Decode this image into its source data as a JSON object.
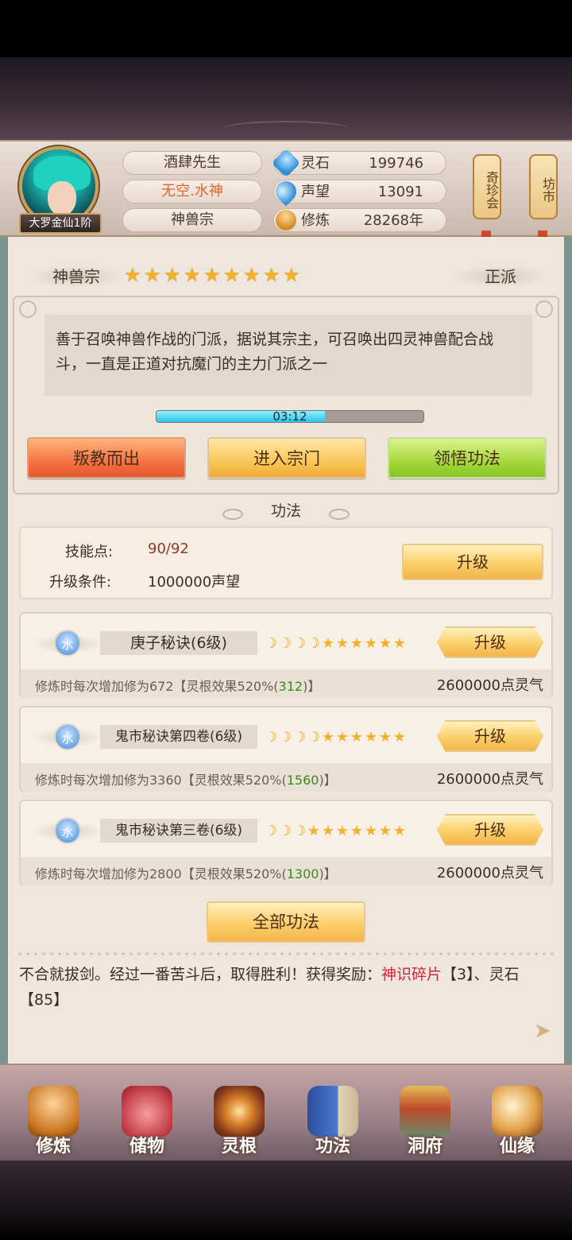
{
  "header": {
    "rank": "大罗金仙1阶",
    "player_name": "酒肆先生",
    "title": "无空.水神",
    "sect": "神兽宗",
    "stats": [
      {
        "icon": "spirit-stone-icon",
        "label": "灵石",
        "value": "199746"
      },
      {
        "icon": "reputation-icon",
        "label": "声望",
        "value": "13091"
      },
      {
        "icon": "cultivation-icon",
        "label": "修炼",
        "value": "28268年"
      }
    ],
    "side_tags": [
      {
        "label": "奇珍会"
      },
      {
        "label": "坊市"
      }
    ]
  },
  "sect_panel": {
    "name": "神兽宗",
    "stars": 9,
    "faction": "正派",
    "description": "善于召唤神兽作战的门派，据说其宗主，可召唤出四灵神兽配合战斗，一直是正道对抗魔门的主力门派之一",
    "timer": "03:12",
    "timer_progress": 0.63,
    "buttons": {
      "leave": "叛教而出",
      "enter": "进入宗门",
      "comprehend": "领悟功法"
    }
  },
  "gongfa": {
    "section_title": "功法",
    "skill_points_label": "技能点:",
    "skill_points_value": "90/92",
    "upgrade_cond_label": "升级条件:",
    "upgrade_cond_value": "1000000声望",
    "upgrade_label": "升级",
    "techniques": [
      {
        "element": "水",
        "name": "庚子秘诀(6级)",
        "moons": 4,
        "stars": 6,
        "desc_prefix": "修炼时每次增加修为672【灵根效果520%(",
        "desc_bonus": "312",
        "desc_suffix": ")】",
        "cost": "2600000点灵气",
        "button": "升级"
      },
      {
        "element": "水",
        "name": "鬼市秘诀第四卷(6级)",
        "moons": 4,
        "stars": 6,
        "desc_prefix": "修炼时每次增加修为3360【灵根效果520%(",
        "desc_bonus": "1560",
        "desc_suffix": ")】",
        "cost": "2600000点灵气",
        "button": "升级"
      },
      {
        "element": "水",
        "name": "鬼市秘诀第三卷(6级)",
        "moons": 3,
        "stars": 7,
        "desc_prefix": "修炼时每次增加修为2800【灵根效果520%(",
        "desc_bonus": "1300",
        "desc_suffix": ")】",
        "cost": "2600000点灵气",
        "button": "升级"
      }
    ],
    "all_button": "全部功法"
  },
  "log": {
    "text1": "不合就拔剑。经过一番苦斗后，取得胜利！获得奖励：",
    "reward1": "神识碎片",
    "text2": "【3】、灵石【85】"
  },
  "nav": [
    {
      "label": "修炼",
      "icon": "cultivate-icon"
    },
    {
      "label": "储物",
      "icon": "storage-bag-icon"
    },
    {
      "label": "灵根",
      "icon": "spirit-root-icon"
    },
    {
      "label": "功法",
      "icon": "technique-book-icon"
    },
    {
      "label": "洞府",
      "icon": "cave-mansion-icon"
    },
    {
      "label": "仙缘",
      "icon": "immortal-fate-icon"
    }
  ]
}
